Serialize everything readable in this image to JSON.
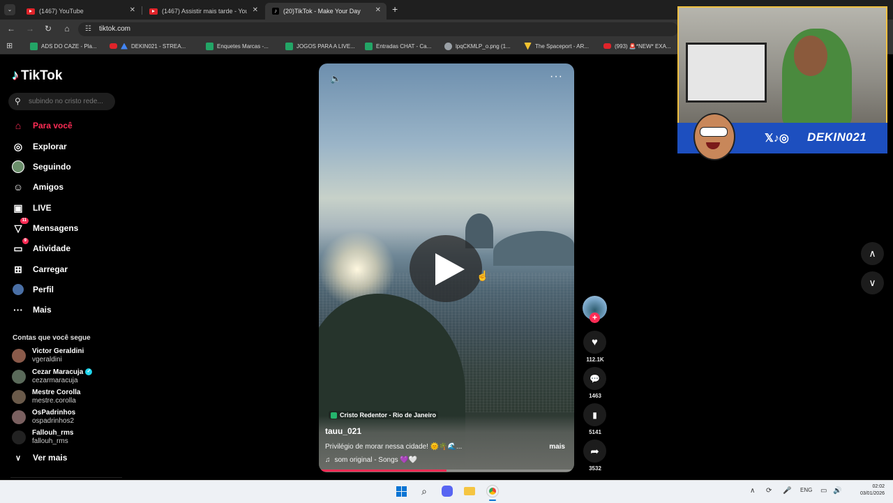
{
  "browser": {
    "tabs": [
      {
        "title": "(1467) YouTube",
        "icon": "youtube-icon"
      },
      {
        "title": "(1467) Assistir mais tarde - You",
        "icon": "youtube-icon"
      },
      {
        "title": "(20)TikTok - Make Your Day",
        "icon": "tiktok-icon",
        "active": true
      }
    ],
    "new_tab": "+",
    "url": "tiktok.com",
    "bookmarks": [
      {
        "label": "ADS DO CAZE - Pla...",
        "color": "#23a566"
      },
      {
        "label": "DEKIN021 - STREA...",
        "color": "#4285f4"
      },
      {
        "label": "Enquetes Marcas -...",
        "color": "#23a566"
      },
      {
        "label": "JOGOS PARA A LIVE...",
        "color": "#23a566"
      },
      {
        "label": "Entradas CHAT - Ca...",
        "color": "#23a566"
      },
      {
        "label": "lpqCKMLP_o.png (1...",
        "color": "#9aa0a6"
      },
      {
        "label": "The Spaceport - AR...",
        "color": "#f2c230"
      },
      {
        "label": "(993) 🚨*NEW* EXA...",
        "color": "#e0242a"
      }
    ]
  },
  "sidebar": {
    "brand": "TikTok",
    "search_placeholder": "subindo no cristo rede...",
    "nav": [
      {
        "label": "Para você",
        "icon": "home-icon",
        "active": true
      },
      {
        "label": "Explorar",
        "icon": "compass-icon"
      },
      {
        "label": "Seguindo",
        "icon": "following-icon"
      },
      {
        "label": "Amigos",
        "icon": "friends-icon"
      },
      {
        "label": "LIVE",
        "icon": "live-icon"
      },
      {
        "label": "Mensagens",
        "icon": "messages-icon",
        "badge": "11"
      },
      {
        "label": "Atividade",
        "icon": "activity-icon",
        "badge": "9"
      },
      {
        "label": "Carregar",
        "icon": "upload-icon"
      },
      {
        "label": "Perfil",
        "icon": "profile-icon"
      },
      {
        "label": "Mais",
        "icon": "more-icon"
      }
    ],
    "following_title": "Contas que você segue",
    "accounts": [
      {
        "name": "Victor Geraldini",
        "handle": "vgeraldini",
        "verified": false
      },
      {
        "name": "Cezar Maracuja",
        "handle": "cezarmaracuja",
        "verified": true
      },
      {
        "name": "Mestre Corolla",
        "handle": "mestre.corolla",
        "verified": false
      },
      {
        "name": "OsPadrinhos",
        "handle": "ospadrinhos2",
        "verified": false
      },
      {
        "name": "Fallouh_rms",
        "handle": "fallouh_rms",
        "verified": false
      }
    ],
    "see_more": "Ver mais"
  },
  "video": {
    "location": "Cristo Redentor - Rio de Janeiro",
    "author": "tauu_021",
    "caption": "Privilégio de morar nessa cidade! 🌞🌴🌊...",
    "more": "mais",
    "sound": "som original - Songs 💜🤍",
    "progress": 0.5
  },
  "actions": {
    "likes": "112.1K",
    "comments": "1463",
    "saves": "5141",
    "shares": "3532"
  },
  "overlay": {
    "streamer_tag": "DEKIN021"
  },
  "taskbar": {
    "lang": "ENG",
    "time": "02:02",
    "date": "03/01/2026"
  }
}
